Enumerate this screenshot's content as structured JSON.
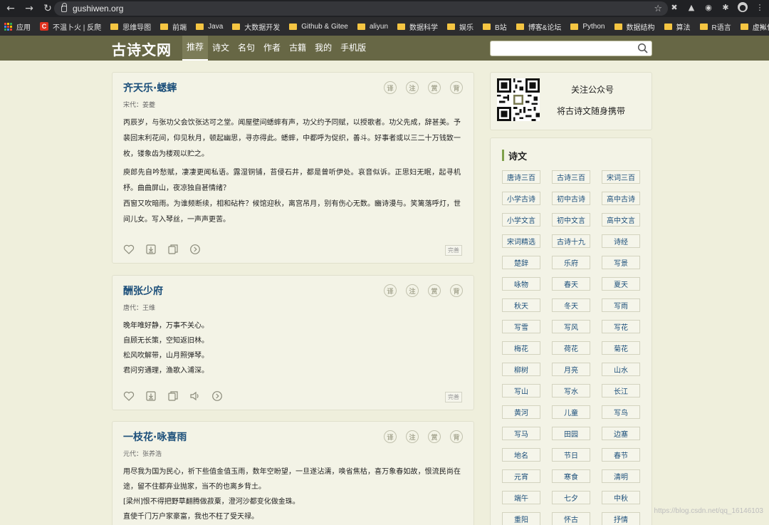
{
  "browser": {
    "url": "gushiwen.org",
    "bookmarks": [
      {
        "label": "应用",
        "type": "apps"
      },
      {
        "label": "不温卜火 | 反爬",
        "type": "red"
      },
      {
        "label": "思维导图",
        "type": "folder"
      },
      {
        "label": "前端",
        "type": "folder"
      },
      {
        "label": "Java",
        "type": "folder"
      },
      {
        "label": "大数据开发",
        "type": "folder"
      },
      {
        "label": "Github & Gitee",
        "type": "folder"
      },
      {
        "label": "aliyun",
        "type": "folder"
      },
      {
        "label": "数据科学",
        "type": "folder"
      },
      {
        "label": "娱乐",
        "type": "folder"
      },
      {
        "label": "B站",
        "type": "folder"
      },
      {
        "label": "博客&论坛",
        "type": "folder"
      },
      {
        "label": "Python",
        "type": "folder"
      },
      {
        "label": "数据结构",
        "type": "folder"
      },
      {
        "label": "算法",
        "type": "folder"
      },
      {
        "label": "R语言",
        "type": "folder"
      },
      {
        "label": "虚拟化",
        "type": "folder"
      }
    ],
    "bookmark_more": "»",
    "red_badge": "C"
  },
  "site": {
    "logo": "古诗文网",
    "nav": [
      "推荐",
      "诗文",
      "名句",
      "作者",
      "古籍",
      "我的",
      "手机版"
    ],
    "search_placeholder": ""
  },
  "badges": [
    "译",
    "注",
    "赏",
    "背"
  ],
  "done_label": "完善",
  "poems": [
    {
      "title": "齐天乐·蟋蟀",
      "source": "宋代：姜夔",
      "paragraphs": [
        "丙辰岁，与张功父会饮张达可之堂。闻屋壁间蟋蟀有声，功父约予同赋，以授歌者。功父先成，辞甚美。予裴回末利花间，仰见秋月，顿起幽思，寻亦得此。蟋蟀，中都呼为促织，善斗。好事者或以三二十万钱致一枚，镂象齿为楼观以贮之。",
        "庾郎先自吟愁赋，凄凄更闻私语。露湿铜铺，苔侵石井，都是曾听伊处。哀音似诉。正思妇无眠，起寻机杼。曲曲屏山，夜凉独自甚情绪？",
        "西窗又吹暗雨。为谁频断续，相和砧杵？候馆迎秋，离宫吊月，别有伤心无数。豳诗漫与。笑篱落呼灯，世间儿女。写入琴丝，一声声更苦。"
      ]
    },
    {
      "title": "酬张少府",
      "source": "唐代：王维",
      "paragraphs": [
        "晚年唯好静，万事不关心。",
        "自顾无长策，空知返旧林。",
        "松风吹解带，山月照弹琴。",
        "君问穷通理，渔歌入浦深。"
      ]
    },
    {
      "title": "一枝花·咏喜雨",
      "source": "元代：张养浩",
      "paragraphs": [
        "用尽我为国为民心，祈下些值金值玉雨，数年空盼望，一旦遂沾濡，唤省焦枯，喜万象春如故，恨流民尚在途，留不住都弃业抛家，当不的也离乡背土。",
        "[梁州]恨不得把野草翻腾做菽粟，澄河沙都变化做金珠。",
        "直使千门万户家豪富，我也不枉了受天禄。"
      ]
    }
  ],
  "sidebar": {
    "qr_line1": "关注公众号",
    "qr_line2": "将古诗文随身携带",
    "section_title": "诗文",
    "tags": [
      "唐诗三百",
      "古诗三百",
      "宋词三百",
      "小学古诗",
      "初中古诗",
      "高中古诗",
      "小学文言",
      "初中文言",
      "高中文言",
      "宋词精选",
      "古诗十九",
      "诗经",
      "楚辞",
      "乐府",
      "写景",
      "咏物",
      "春天",
      "夏天",
      "秋天",
      "冬天",
      "写雨",
      "写雪",
      "写风",
      "写花",
      "梅花",
      "荷花",
      "菊花",
      "柳树",
      "月亮",
      "山水",
      "写山",
      "写水",
      "长江",
      "黄河",
      "儿童",
      "写鸟",
      "写马",
      "田园",
      "边塞",
      "地名",
      "节日",
      "春节",
      "元宵",
      "寒食",
      "清明",
      "端午",
      "七夕",
      "中秋",
      "重阳",
      "怀古",
      "抒情"
    ]
  },
  "watermark": "https://blog.csdn.net/qq_16146103"
}
